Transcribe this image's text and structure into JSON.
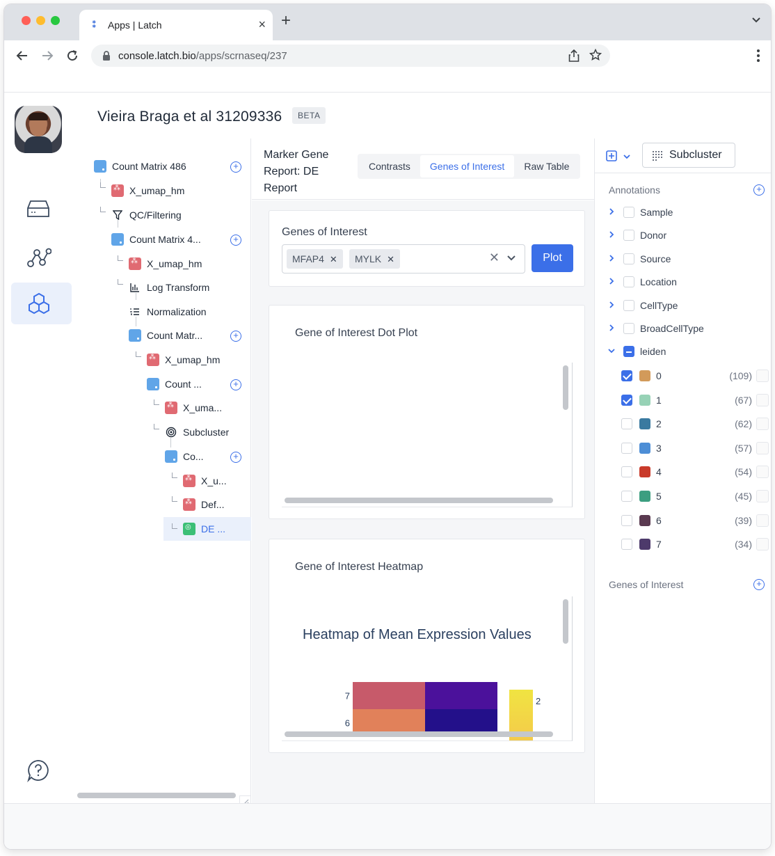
{
  "browser": {
    "tab_title": "Apps | Latch",
    "url_host": "console.latch.bio",
    "url_path": "/apps/scrnaseq/237"
  },
  "header": {
    "title": "Vieira Braga et al 31209336",
    "badge": "BETA"
  },
  "tree": {
    "items": [
      {
        "label": "Count Matrix 486"
      },
      {
        "label": "X_umap_hm"
      },
      {
        "label": "QC/Filtering"
      },
      {
        "label": "Count Matrix 4..."
      },
      {
        "label": "X_umap_hm"
      },
      {
        "label": "Log Transform"
      },
      {
        "label": "Normalization"
      },
      {
        "label": "Count Matr..."
      },
      {
        "label": "X_umap_hm"
      },
      {
        "label": "Count ..."
      },
      {
        "label": "X_uma..."
      },
      {
        "label": "Subcluster"
      },
      {
        "label": "Co..."
      },
      {
        "label": "X_u..."
      },
      {
        "label": "Def..."
      },
      {
        "label": "DE ..."
      }
    ]
  },
  "report": {
    "title": "Marker Gene Report: DE Report",
    "tabs": [
      "Contrasts",
      "Genes of Interest",
      "Raw Table"
    ],
    "active_tab": "Genes of Interest",
    "genes_card": {
      "title": "Genes of Interest",
      "chips": [
        "MFAP4",
        "MYLK"
      ],
      "plot_button": "Plot"
    },
    "dot_plot_card": {
      "title": "Gene of Interest Dot Plot"
    },
    "heatmap_card": {
      "title": "Gene of Interest Heatmap",
      "chart_title": "Heatmap of Mean Expression Values"
    }
  },
  "chart_data": {
    "type": "heatmap",
    "title": "Heatmap of Mean Expression Values",
    "y_categories_visible": [
      "7",
      "6"
    ],
    "colorbar_tick_visible": "2",
    "cells": [
      {
        "row": "7",
        "col": 0,
        "color": "#c75a6a"
      },
      {
        "row": "7",
        "col": 1,
        "color": "#4b119b"
      },
      {
        "row": "6",
        "col": 0,
        "color": "#e1815a"
      },
      {
        "row": "6",
        "col": 1,
        "color": "#23108a"
      }
    ],
    "colorscale": [
      "#f0e442",
      "#f5c84a"
    ]
  },
  "right_panel": {
    "subcluster_button": "Subcluster",
    "annotations_label": "Annotations",
    "annotations": [
      "Sample",
      "Donor",
      "Source",
      "Location",
      "CellType",
      "BroadCellType",
      "leiden"
    ],
    "leiden": [
      {
        "label": "0",
        "count": "(109)",
        "color": "#d29a5a",
        "checked": true
      },
      {
        "label": "1",
        "count": "(67)",
        "color": "#97d2b6",
        "checked": true
      },
      {
        "label": "2",
        "count": "(62)",
        "color": "#3a7aa0",
        "checked": false
      },
      {
        "label": "3",
        "count": "(57)",
        "color": "#4d8ed6",
        "checked": false
      },
      {
        "label": "4",
        "count": "(54)",
        "color": "#c93a2a",
        "checked": false
      },
      {
        "label": "5",
        "count": "(45)",
        "color": "#3c9e80",
        "checked": false
      },
      {
        "label": "6",
        "count": "(39)",
        "color": "#5a3a50",
        "checked": false
      },
      {
        "label": "7",
        "count": "(34)",
        "color": "#4d3a6b",
        "checked": false
      }
    ],
    "genes_label": "Genes of Interest"
  }
}
